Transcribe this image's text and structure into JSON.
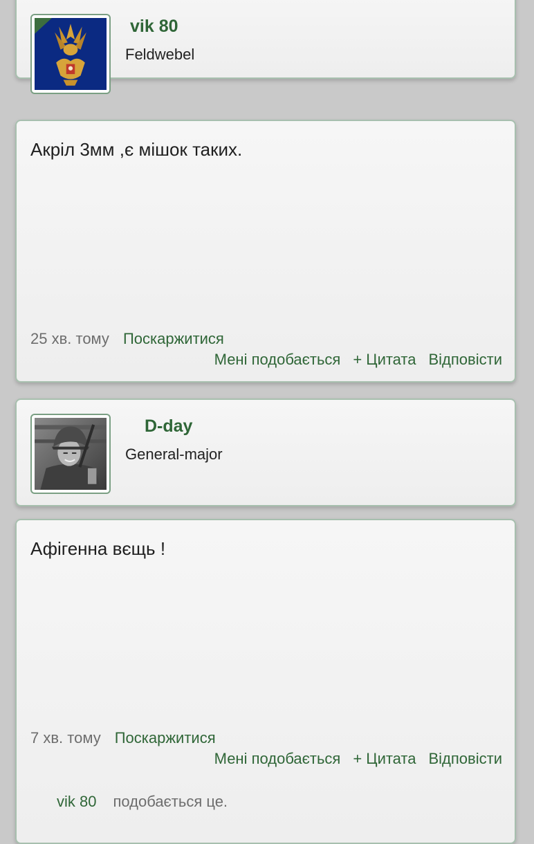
{
  "posts": [
    {
      "author": {
        "name": "vik 80",
        "rank": "Feldwebel",
        "avatar_icon": "imperial-eagle-emblem"
      },
      "text": "Акріл 3мм ,є мішок таких.",
      "time": "25 хв. тому",
      "report_label": "Поскаржитися",
      "like_label": "Мені подобається",
      "quote_label": "+ Цитата",
      "reply_label": "Відповісти"
    },
    {
      "author": {
        "name": "D-day",
        "rank": "General-major",
        "avatar_icon": "soldier-photo"
      },
      "text": "Афігенна вєщь !",
      "time": "7 хв. тому",
      "report_label": "Поскаржитися",
      "like_label": "Мені подобається",
      "quote_label": "+ Цитата",
      "reply_label": "Відповісти",
      "likes": {
        "user": "vik 80",
        "text": "подобається це."
      }
    }
  ],
  "colors": {
    "accent": "#2f6637",
    "card_border": "#a7bfae",
    "page_bg": "#c9c9c9"
  }
}
